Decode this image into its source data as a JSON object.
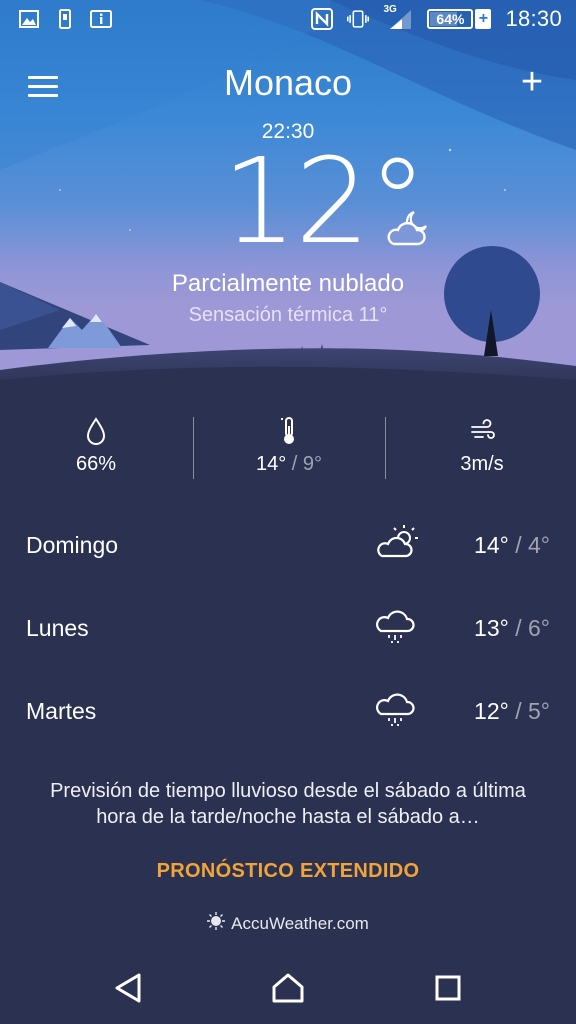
{
  "status_bar": {
    "battery_level": "64%",
    "battery_fraction": 0.64,
    "network": "3G",
    "time": "18:30",
    "icons_left": [
      "image-icon",
      "device-icon",
      "info-icon"
    ],
    "icons_right": [
      "nfc-icon",
      "vibrate-icon",
      "signal-icon",
      "battery-icon"
    ]
  },
  "header": {
    "city": "Monaco",
    "menu_icon": "hamburger-icon",
    "add_label": "+"
  },
  "current": {
    "time": "22:30",
    "temperature": "12°",
    "condition": "Parcialmente nublado",
    "feels_like": "Sensación térmica 11°",
    "icon": "partly-cloudy-night-icon"
  },
  "stats": {
    "humidity": "66%",
    "temp_high": "14°",
    "temp_low": "/ 9°",
    "wind": "3m/s"
  },
  "forecast": [
    {
      "day": "Domingo",
      "icon": "partly-cloudy-day-icon",
      "high": "14°",
      "low": "/ 4°"
    },
    {
      "day": "Lunes",
      "icon": "rain-icon",
      "high": "13°",
      "low": "/ 6°"
    },
    {
      "day": "Martes",
      "icon": "rain-icon",
      "high": "12°",
      "low": "/ 5°"
    }
  ],
  "summary": "Previsión de tiempo lluvioso desde el sábado a última hora de la tarde/noche hasta el sábado a…",
  "extended_label": "PRONÓSTICO EXTENDIDO",
  "provider": "AccuWeather.com",
  "colors": {
    "background": "#2b3150",
    "accent": "#f0a43a",
    "sky_top": "#2d78c8"
  }
}
